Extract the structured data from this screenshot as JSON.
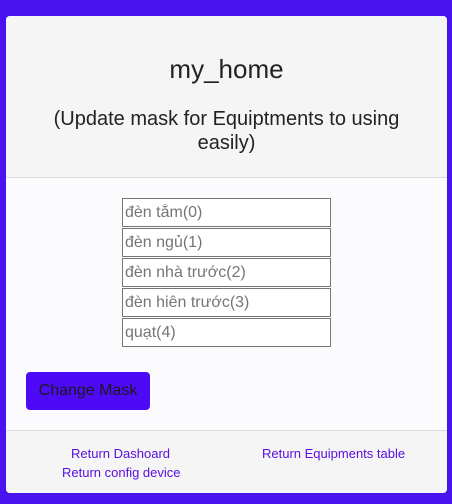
{
  "header": {
    "title": "my_home",
    "subtitle": "(Update mask for Equiptments to using easily)"
  },
  "inputs": [
    {
      "placeholder": "đèn tắm(0)",
      "value": ""
    },
    {
      "placeholder": "đèn ngủ(1)",
      "value": ""
    },
    {
      "placeholder": "đèn nhà trước(2)",
      "value": ""
    },
    {
      "placeholder": "đèn hiên trước(3)",
      "value": ""
    },
    {
      "placeholder": "quạt(4)",
      "value": ""
    }
  ],
  "actions": {
    "change_mask_label": "Change Mask"
  },
  "footer": {
    "return_dashboard": "Return Dashoard",
    "return_config": "Return config device",
    "return_equipments": "Return Equipments table"
  },
  "colors": {
    "background": "#4a12f0",
    "button": "#4f0af5",
    "link": "#5a10e0"
  }
}
